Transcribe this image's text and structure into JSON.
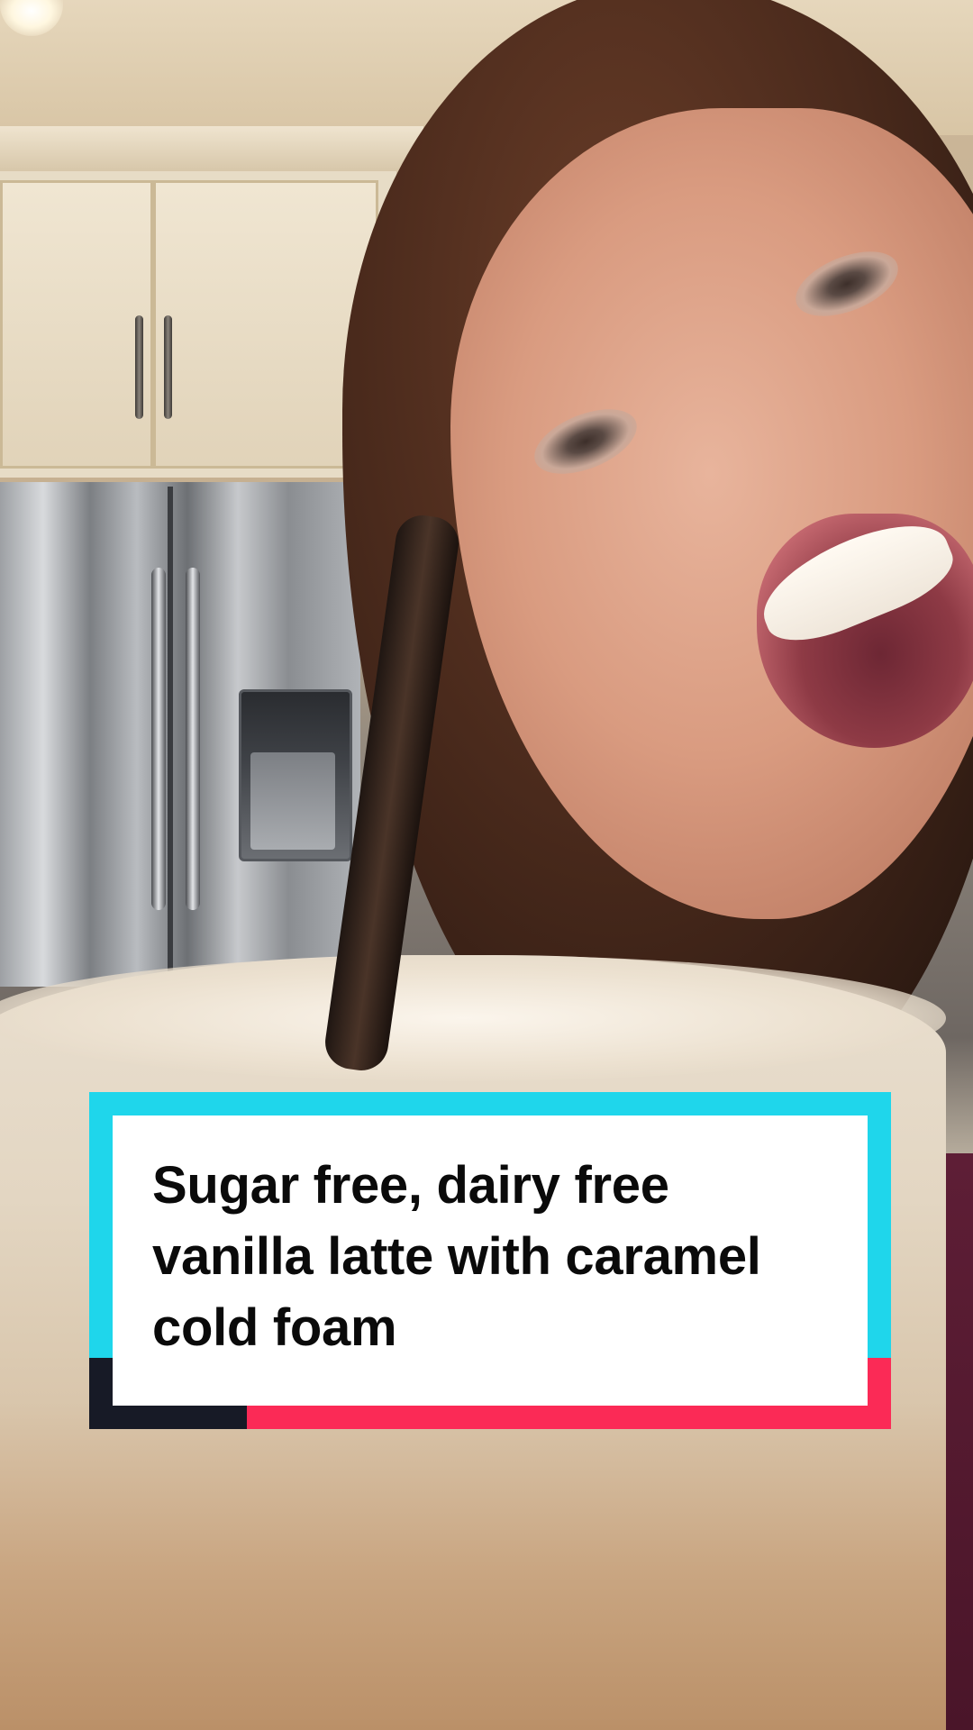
{
  "caption": {
    "lines": [
      "Sugar free, dairy free",
      "vanilla latte with caramel",
      "cold foam"
    ]
  },
  "colors": {
    "caption_border_primary": "#1fd6eb",
    "caption_accent_red": "#fb2a56",
    "caption_accent_dark": "#171a26",
    "caption_background": "#ffffff",
    "caption_text": "#0a0a0a"
  }
}
